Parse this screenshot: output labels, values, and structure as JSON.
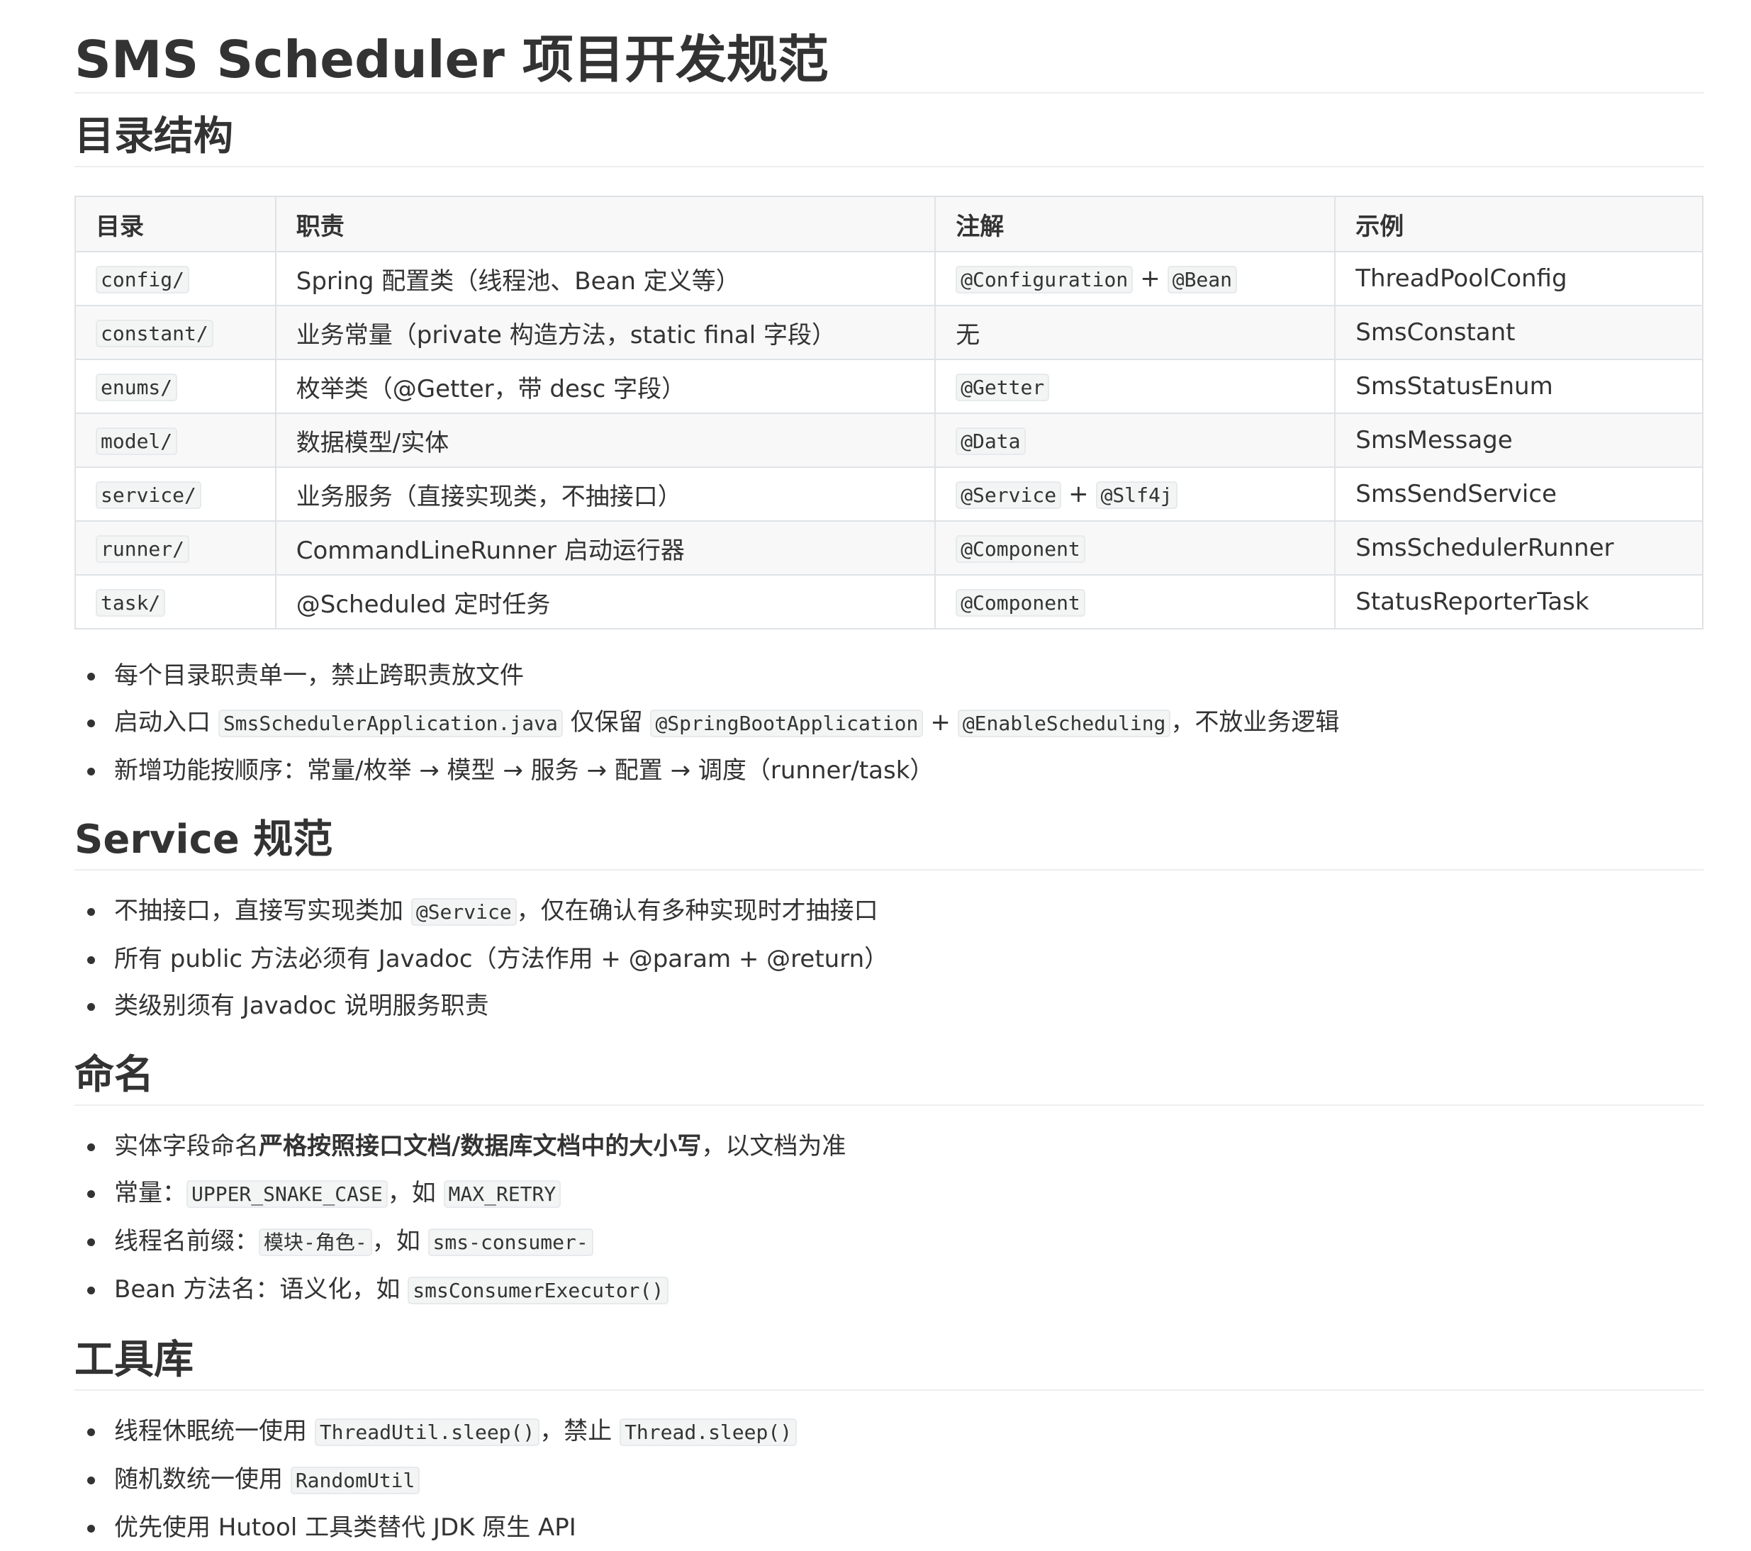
{
  "title": "SMS Scheduler 项目开发规范",
  "sections": {
    "dirs": {
      "heading": "目录结构",
      "table": {
        "headers": [
          "目录",
          "职责",
          "注解",
          "示例"
        ],
        "rows": [
          {
            "dir": "config/",
            "duty": "Spring 配置类（线程池、Bean 定义等）",
            "ann": [
              "@Configuration",
              "@Bean"
            ],
            "example": "ThreadPoolConfig"
          },
          {
            "dir": "constant/",
            "duty": "业务常量（private 构造方法，static final 字段）",
            "ann_text": "无",
            "example": "SmsConstant"
          },
          {
            "dir": "enums/",
            "duty": "枚举类（@Getter，带 desc 字段）",
            "ann": [
              "@Getter"
            ],
            "example": "SmsStatusEnum"
          },
          {
            "dir": "model/",
            "duty": "数据模型/实体",
            "ann": [
              "@Data"
            ],
            "example": "SmsMessage"
          },
          {
            "dir": "service/",
            "duty": "业务服务（直接实现类，不抽接口）",
            "ann": [
              "@Service",
              "@Slf4j"
            ],
            "example": "SmsSendService"
          },
          {
            "dir": "runner/",
            "duty": "CommandLineRunner 启动运行器",
            "ann": [
              "@Component"
            ],
            "example": "SmsSchedulerRunner"
          },
          {
            "dir": "task/",
            "duty": "@Scheduled 定时任务",
            "ann": [
              "@Component"
            ],
            "example": "StatusReporterTask"
          }
        ]
      },
      "bullets": {
        "b1": "每个目录职责单一，禁止跨职责放文件",
        "b2_prefix": "启动入口 ",
        "b2_code1": "SmsSchedulerApplication.java",
        "b2_mid": " 仅保留 ",
        "b2_code2": "@SpringBootApplication",
        "b2_plus": "+",
        "b2_code3": "@EnableScheduling",
        "b2_suffix": "，不放业务逻辑",
        "b3": "新增功能按顺序：常量/枚举 → 模型 → 服务 → 配置 → 调度（runner/task）"
      }
    },
    "service": {
      "heading": "Service 规范",
      "b1_prefix": "不抽接口，直接写实现类加 ",
      "b1_code": "@Service",
      "b1_suffix": "，仅在确认有多种实现时才抽接口",
      "b2": "所有 public 方法必须有 Javadoc（方法作用 + @param + @return）",
      "b3": "类级别须有 Javadoc 说明服务职责"
    },
    "naming": {
      "heading": "命名",
      "b1_prefix": "实体字段命名",
      "b1_bold": "严格按照接口文档/数据库文档中的大小写",
      "b1_suffix": "，以文档为准",
      "b2_prefix": "常量：",
      "b2_code1": "UPPER_SNAKE_CASE",
      "b2_mid": "，如 ",
      "b2_code2": "MAX_RETRY",
      "b3_prefix": "线程名前缀：",
      "b3_code1": "模块-角色-",
      "b3_mid": "，如 ",
      "b3_code2": "sms-consumer-",
      "b4_prefix": "Bean 方法名：语义化，如 ",
      "b4_code": "smsConsumerExecutor()"
    },
    "tools": {
      "heading": "工具库",
      "b1_prefix": "线程休眠统一使用 ",
      "b1_code1": "ThreadUtil.sleep()",
      "b1_mid": "，禁止 ",
      "b1_code2": "Thread.sleep()",
      "b2_prefix": "随机数统一使用 ",
      "b2_code": "RandomUtil",
      "b3": "优先使用 Hutool 工具类替代 JDK 原生 API"
    }
  }
}
